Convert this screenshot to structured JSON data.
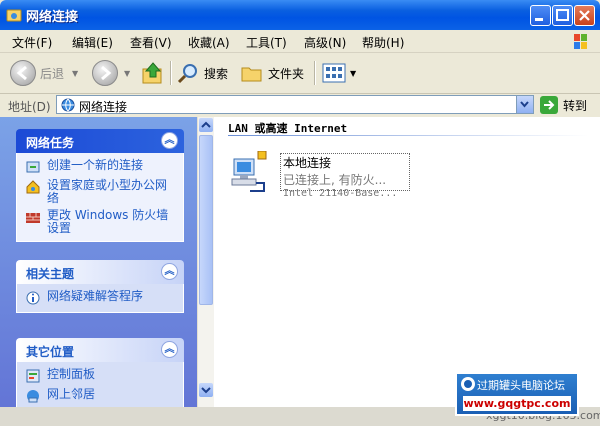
{
  "window": {
    "title": "网络连接"
  },
  "menu": {
    "items": [
      "文件(F)",
      "编辑(E)",
      "查看(V)",
      "收藏(A)",
      "工具(T)",
      "高级(N)",
      "帮助(H)"
    ]
  },
  "toolbar": {
    "back": "后退",
    "search": "搜索",
    "folders": "文件夹"
  },
  "address": {
    "label": "地址(D)",
    "value": "网络连接",
    "go": "转到"
  },
  "tasks": {
    "network_tasks": {
      "title": "网络任务",
      "items": [
        "创建一个新的连接",
        "设置家庭或小型办公网络",
        "更改 Windows 防火墙设置"
      ]
    },
    "related": {
      "title": "相关主题",
      "items": [
        "网络疑难解答程序"
      ]
    },
    "other": {
      "title": "其它位置",
      "items": [
        "控制面板",
        "网上邻居"
      ]
    }
  },
  "content": {
    "group": "LAN 或高速 Internet",
    "connection": {
      "name": "本地连接",
      "status": "已连接上, 有防火...",
      "device": "Intel 21140-Base..."
    }
  },
  "watermark": {
    "title": "过期罐头电脑论坛",
    "url": "www.gqgtpc.com",
    "small": "xggt10.blog.163.com"
  },
  "colors": {
    "titlebar": "#0054e3",
    "taskpane": "#7ba2e7",
    "link": "#215dc6"
  }
}
